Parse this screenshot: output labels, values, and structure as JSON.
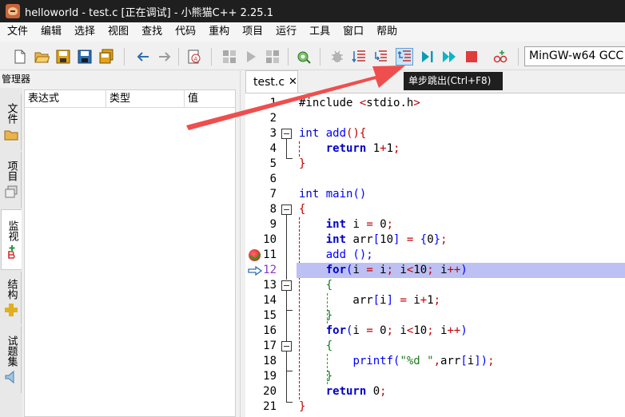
{
  "window": {
    "title": "helloworld - test.c [正在调试] - 小熊猫C++ 2.25.1"
  },
  "menu": {
    "items": [
      "文件",
      "编辑",
      "选择",
      "视图",
      "查找",
      "代码",
      "重构",
      "项目",
      "运行",
      "工具",
      "窗口",
      "帮助"
    ]
  },
  "toolbar": {
    "buttons": [
      "new-file-icon",
      "open-file-icon",
      "save-icon",
      "save-as-icon",
      "save-all-icon",
      "back-icon",
      "forward-icon",
      "format-icon",
      "compile-icon",
      "run-icon",
      "compile-run-icon",
      "rebuild-icon",
      "debug-icon",
      "step-over-icon",
      "step-into-icon",
      "step-out-icon",
      "run-to-cursor-icon",
      "continue-icon",
      "stop-icon",
      "add-watch-icon"
    ],
    "compiler": "MinGW-w64 GCC",
    "tooltip": "单步跳出(Ctrl+F8)"
  },
  "left_panel": {
    "title": "管理器",
    "side_tabs": [
      "文件",
      "项目",
      "监视",
      "结构",
      "试题集"
    ],
    "active_tab": "监视",
    "watch_columns": [
      "表达式",
      "类型",
      "值"
    ]
  },
  "editor": {
    "tab_label": "test.c",
    "tab_close": "✕",
    "breakpoint_line": 11,
    "current_line": 12,
    "line_numbers": [
      "1",
      "2",
      "3",
      "4",
      "5",
      "6",
      "7",
      "8",
      "9",
      "10",
      "11",
      "12",
      "13",
      "14",
      "15",
      "16",
      "17",
      "18",
      "19",
      "20",
      "21"
    ],
    "lines": [
      "#include <stdio.h>",
      "",
      "int add(){",
      "    return 1+1;",
      "}",
      "",
      "int main()",
      "{",
      "    int i = 0;",
      "    int arr[10] = {0};",
      "    add ();",
      "    for(i = i; i<10; i++)",
      "    {",
      "        arr[i] = i+1;",
      "    }",
      "    for(i = 0; i<10; i++)",
      "    {",
      "        printf(\"%d \",arr[i]);",
      "    }",
      "    return 0;",
      "}"
    ]
  },
  "colors": {
    "keyword": "#0000c8",
    "operator": "#c00000",
    "string": "#1f7a1f",
    "current_line_bg": "#bcc0f3",
    "annotation_arrow": "#ef4e4e"
  }
}
